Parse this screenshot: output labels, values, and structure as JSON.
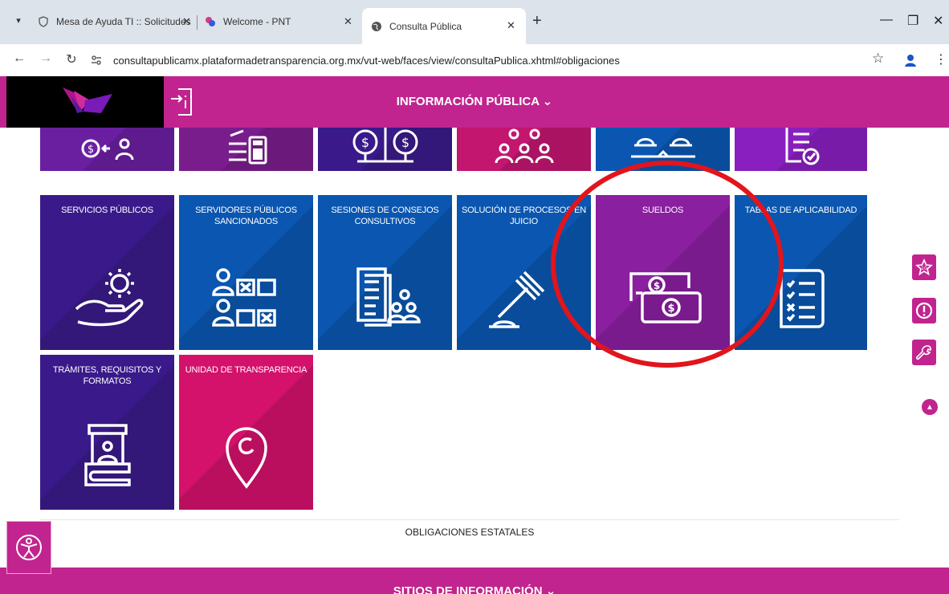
{
  "browser": {
    "tabs": [
      {
        "title": "Mesa de Ayuda TI :: Solicitudes",
        "active": false
      },
      {
        "title": "Welcome - PNT",
        "active": false
      },
      {
        "title": "Consulta Pública",
        "active": true
      }
    ],
    "url": "consultapublicamx.plataformadetransparencia.org.mx/vut-web/faces/view/consultaPublica.xhtml#obligaciones"
  },
  "header": {
    "title": "INFORMACIÓN PÚBLICA ⌄"
  },
  "tiles_row0": [
    {
      "icon": "money-transfer-icon",
      "color": "#6a1fa0"
    },
    {
      "icon": "document-calculator-icon",
      "color": "#7a1d8c"
    },
    {
      "icon": "money-tree-icon",
      "color": "#3a1a8a"
    },
    {
      "icon": "people-group-icon",
      "color": "#c2166f"
    },
    {
      "icon": "balance-scale-icon",
      "color": "#0a56b0"
    },
    {
      "icon": "checklist-icon",
      "color": "#8a1fc0"
    }
  ],
  "tiles": [
    {
      "label": "SERVICIOS PÚBLICOS",
      "icon": "gear-hand-icon",
      "color": "#3a1a8a"
    },
    {
      "label": "SERVIDORES PÚBLICOS SANCIONADOS",
      "icon": "sanctions-grid-icon",
      "color": "#0a56b0"
    },
    {
      "label": "SESIONES DE CONSEJOS CONSULTIVOS",
      "icon": "meeting-documents-icon",
      "color": "#0a56b0"
    },
    {
      "label": "SOLUCIÓN DE PROCESOS EN JUICIO",
      "icon": "gavel-icon",
      "color": "#0a56b0"
    },
    {
      "label": "SUELDOS",
      "icon": "salary-bills-icon",
      "color": "#8a1fa0"
    },
    {
      "label": "TABLAS DE APLICABILIDAD",
      "icon": "applicability-list-icon",
      "color": "#0a56b0"
    },
    {
      "label": "TRÁMITES, REQUISITOS Y FORMATOS",
      "icon": "service-window-icon",
      "color": "#3a1a8a"
    },
    {
      "label": "UNIDAD DE TRANSPARENCIA",
      "icon": "location-pin-icon",
      "color": "#d4116b"
    }
  ],
  "obligaciones_label": "OBLIGACIONES ESTATALES",
  "footer": {
    "title": "SITIOS DE INFORMACIÓN ⌄"
  },
  "side_buttons": [
    "top10-star-icon",
    "alert-icon",
    "wrench-icon"
  ]
}
